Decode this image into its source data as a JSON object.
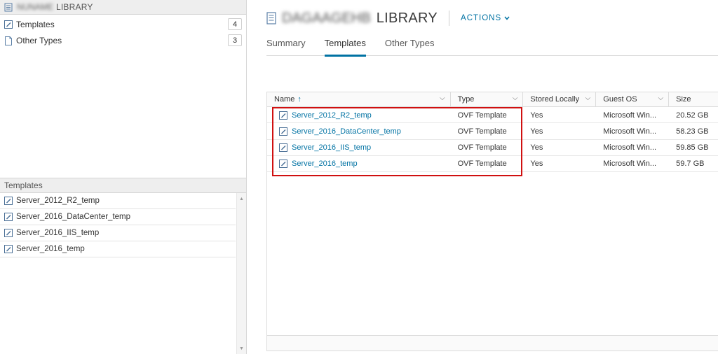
{
  "navigator": {
    "library_label": "LIBRARY",
    "redacted_name": "NUNAME",
    "tree": [
      {
        "label": "Templates",
        "count": "4",
        "icon": "template-icon"
      },
      {
        "label": "Other Types",
        "count": "3",
        "icon": "file-icon"
      }
    ]
  },
  "templates_panel": {
    "title": "Templates",
    "items": [
      "Server_2012_R2_temp",
      "Server_2016_DataCenter_temp",
      "Server_2016_IIS_temp",
      "Server_2016_temp"
    ]
  },
  "header": {
    "redacted_name": "DAGAAGEHB",
    "library_label": "LIBRARY",
    "actions_label": "ACTIONS"
  },
  "tabs": [
    {
      "label": "Summary",
      "active": false
    },
    {
      "label": "Templates",
      "active": true
    },
    {
      "label": "Other Types",
      "active": false
    }
  ],
  "grid": {
    "columns": [
      "Name",
      "Type",
      "Stored Locally",
      "Guest OS",
      "Size"
    ],
    "rows": [
      {
        "name": "Server_2012_R2_temp",
        "type": "OVF Template",
        "stored": "Yes",
        "os": "Microsoft Win...",
        "size": "20.52 GB"
      },
      {
        "name": "Server_2016_DataCenter_temp",
        "type": "OVF Template",
        "stored": "Yes",
        "os": "Microsoft Win...",
        "size": "58.23 GB"
      },
      {
        "name": "Server_2016_IIS_temp",
        "type": "OVF Template",
        "stored": "Yes",
        "os": "Microsoft Win...",
        "size": "59.85 GB"
      },
      {
        "name": "Server_2016_temp",
        "type": "OVF Template",
        "stored": "Yes",
        "os": "Microsoft Win...",
        "size": "59.7 GB"
      }
    ]
  },
  "colors": {
    "accent": "#0072a3",
    "highlight": "#d01010"
  }
}
